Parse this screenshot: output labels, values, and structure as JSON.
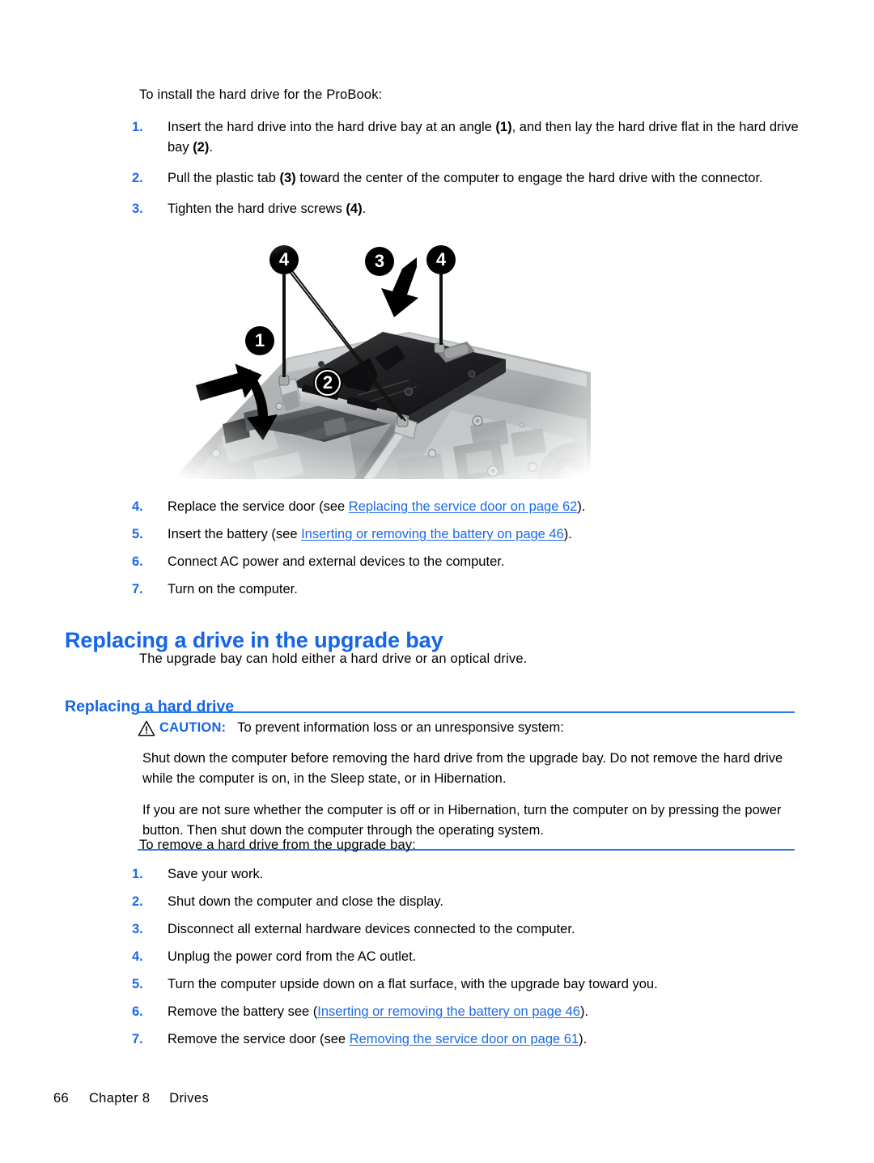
{
  "intro": {
    "text": "To install the hard drive for the ProBook:"
  },
  "install_steps": [
    {
      "num": "1.",
      "parts": [
        {
          "t": "Insert the hard drive into the hard drive bay at an angle "
        },
        {
          "t": "(1)",
          "style": "bold"
        },
        {
          "t": ", and then lay the hard drive flat in the hard drive bay "
        },
        {
          "t": "(2)",
          "style": "bold"
        },
        {
          "t": "."
        }
      ]
    },
    {
      "num": "2.",
      "parts": [
        {
          "t": "Pull the plastic tab "
        },
        {
          "t": "(3)",
          "style": "bold"
        },
        {
          "t": " toward the center of the computer to engage the hard drive with the connector."
        }
      ]
    },
    {
      "num": "3.",
      "parts": [
        {
          "t": "Tighten the hard drive screws "
        },
        {
          "t": "(4)",
          "style": "bold"
        },
        {
          "t": "."
        }
      ]
    }
  ],
  "install_steps_after": [
    {
      "num": "4.",
      "parts": [
        {
          "t": "Replace the service door (see "
        },
        {
          "t": "Replacing the service door on page 62",
          "style": "link"
        },
        {
          "t": ")."
        }
      ]
    },
    {
      "num": "5.",
      "parts": [
        {
          "t": "Insert the battery (see "
        },
        {
          "t": "Inserting or removing the battery on page 46",
          "style": "link"
        },
        {
          "t": ")."
        }
      ]
    },
    {
      "num": "6.",
      "parts": [
        {
          "t": "Connect AC power and external devices to the computer."
        }
      ]
    },
    {
      "num": "7.",
      "parts": [
        {
          "t": "Turn on the computer."
        }
      ]
    }
  ],
  "heading_upgrade_bay": "Replacing a drive in the upgrade bay",
  "upgrade_bay_intro": "The upgrade bay can hold either a hard drive or an optical drive.",
  "heading_hard_drive": "Replacing a hard drive",
  "caution": {
    "icon": "warning-triangle-icon",
    "label": "CAUTION:",
    "lead": "To prevent information loss or an unresponsive system:",
    "paragraphs": [
      "Shut down the computer before removing the hard drive from the upgrade bay. Do not remove the hard drive while the computer is on, in the Sleep state, or in Hibernation.",
      "If you are not sure whether the computer is off or in Hibernation, turn the computer on by pressing the power button. Then shut down the computer through the operating system."
    ]
  },
  "remove_intro": "To remove a hard drive from the upgrade bay:",
  "remove_steps": [
    {
      "num": "1.",
      "parts": [
        {
          "t": "Save your work."
        }
      ]
    },
    {
      "num": "2.",
      "parts": [
        {
          "t": "Shut down the computer and close the display."
        }
      ]
    },
    {
      "num": "3.",
      "parts": [
        {
          "t": "Disconnect all external hardware devices connected to the computer."
        }
      ]
    },
    {
      "num": "4.",
      "parts": [
        {
          "t": "Unplug the power cord from the AC outlet."
        }
      ]
    },
    {
      "num": "5.",
      "parts": [
        {
          "t": "Turn the computer upside down on a flat surface, with the upgrade bay toward you."
        }
      ]
    },
    {
      "num": "6.",
      "parts": [
        {
          "t": "Remove the battery see ("
        },
        {
          "t": "Inserting or removing the battery on page 46",
          "style": "link"
        },
        {
          "t": ")."
        }
      ]
    },
    {
      "num": "7.",
      "parts": [
        {
          "t": "Remove the service door (see "
        },
        {
          "t": "Removing the service door on page 61",
          "style": "link"
        },
        {
          "t": ")."
        }
      ]
    }
  ],
  "figure": {
    "alt": "Illustration of a laptop bottom chassis with a hard drive being inserted into the hard drive bay",
    "callouts": [
      "4",
      "3",
      "4",
      "1",
      "2"
    ]
  },
  "footer": {
    "page_number": "66",
    "chapter": "Chapter 8",
    "section": "Drives"
  },
  "colors": {
    "accent_blue": "#1565e8",
    "link_blue": "#1a6ae8",
    "rule_blue": "#2b7ce8",
    "text_black": "#000000",
    "page_bg": "#ffffff"
  }
}
